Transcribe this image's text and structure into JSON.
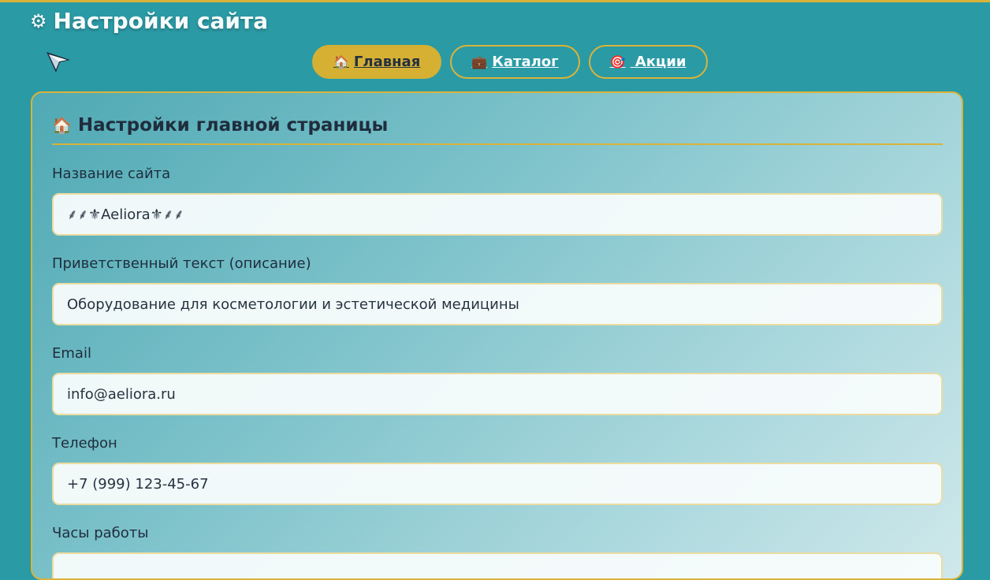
{
  "page": {
    "title": "Настройки сайта",
    "gear_icon": "⚙"
  },
  "tabs": [
    {
      "label": "Главная",
      "icon": "🏠",
      "active": true
    },
    {
      "label": "Каталог",
      "icon": "💼",
      "active": false
    },
    {
      "label": " Акции",
      "icon": "🎯",
      "active": false
    }
  ],
  "card": {
    "title": "Настройки главной страницы",
    "icon": "🏠"
  },
  "fields": {
    "site_name": {
      "label": "Название сайта",
      "value": "⸙⸙⚜Aeliora⚜⸙⸙"
    },
    "welcome": {
      "label": "Приветственный текст (описание)",
      "value": "Оборудование для косметологии и эстетической медицины"
    },
    "email": {
      "label": "Email",
      "value": "info@aeliora.ru"
    },
    "phone": {
      "label": "Телефон",
      "value": "+7 (999) 123-45-67"
    },
    "hours": {
      "label": "Часы работы",
      "value": ""
    }
  },
  "colors": {
    "background": "#2a9aa5",
    "accent": "#d9b33a",
    "text_dark": "#1f2d3d"
  }
}
